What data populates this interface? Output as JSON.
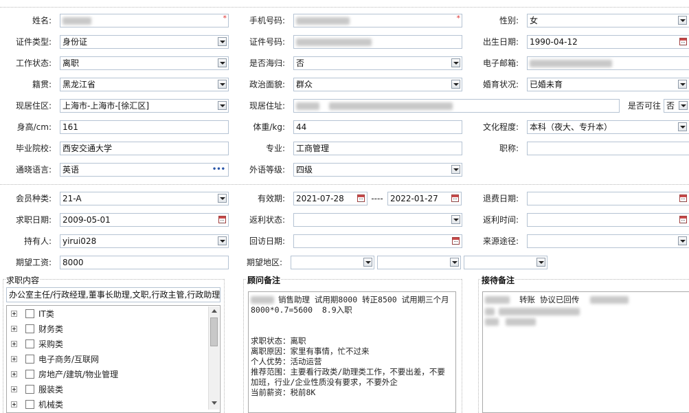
{
  "labels": {
    "name": "姓名:",
    "mobile": "手机号码:",
    "gender": "性别:",
    "id_type": "证件类型:",
    "id_no": "证件号码:",
    "birth": "出生日期:",
    "work_status": "工作状态:",
    "overseas": "是否海归:",
    "email": "电子邮箱:",
    "native": "籍贯:",
    "politics": "政治面貌:",
    "marital": "婚育状况:",
    "residence_area": "现居住区:",
    "residence_addr": "现居住址:",
    "can_travel": "是否可往",
    "height": "身高/cm:",
    "weight": "体重/kg:",
    "education": "文化程度:",
    "school": "毕业院校:",
    "major": "专业:",
    "title": "职称:",
    "language": "通晓语言:",
    "lang_level": "外语等级:",
    "member_type": "会员种类:",
    "valid_period": "有效期:",
    "refund_date": "退费日期:",
    "job_date": "求职日期:",
    "rebate_status": "返利状态:",
    "rebate_time": "返利时间:",
    "holder": "持有人:",
    "revisit_date": "回访日期:",
    "source": "来源途径:",
    "expected_salary": "期望工资:",
    "expected_area": "期望地区:",
    "period_sep": "----"
  },
  "values": {
    "gender": "女",
    "id_type": "身份证",
    "birth": "1990-04-12",
    "work_status": "离职",
    "overseas": "否",
    "native": "黑龙江省",
    "politics": "群众",
    "marital": "已婚未育",
    "residence_area": "上海市-上海市-[徐汇区]",
    "can_travel": "否",
    "height": "161",
    "weight": "44",
    "education": "本科（夜大、专升本）",
    "school": "西安交通大学",
    "major": "工商管理",
    "title": "",
    "language": "英语",
    "language_more": "•••",
    "lang_level": "四级",
    "member_type": "21-A",
    "valid_from": "2021-07-28",
    "valid_to": "2022-01-27",
    "refund_date": "",
    "job_date": "2009-05-01",
    "rebate_status": "",
    "rebate_time": "",
    "holder": "yirui028",
    "revisit_date": "",
    "source": "",
    "expected_salary": "8000",
    "area1": "",
    "area2": "",
    "area3": ""
  },
  "sections": {
    "job_intent": "求职内容",
    "consultant_note": "顾问备注",
    "reception_note": "接待备注"
  },
  "job_intent_text": "办公室主任/行政经理,董事长助理,文职,行政主管,行政助理",
  "tree": [
    "IT类",
    "财务类",
    "采购类",
    "电子商务/互联网",
    "房地产/建筑/物业管理",
    "服装类",
    "机械类"
  ],
  "consultant_note_text": "销售助理 试用期8000 转正8500 试用期三个月\n8000*0.7=5600  8.9入职\n\n\n求职状态：离职\n离职原因：家里有事情，忙不过来\n个人优势：活动运营\n推荐范围：主要看行政类/助理类工作，不要出差，不要\n加班，行业/企业性质没有要求，不要外企\n当前薪资：税前8K",
  "reception_note_text": "转账 协议已回传",
  "colors": {
    "required_star": "#dd3333",
    "border": "#b5c3d3"
  },
  "icons": [
    "dropdown-arrow-icon",
    "calendar-icon",
    "expand-plus-icon",
    "checkbox-icon",
    "ellipsis-icon"
  ]
}
